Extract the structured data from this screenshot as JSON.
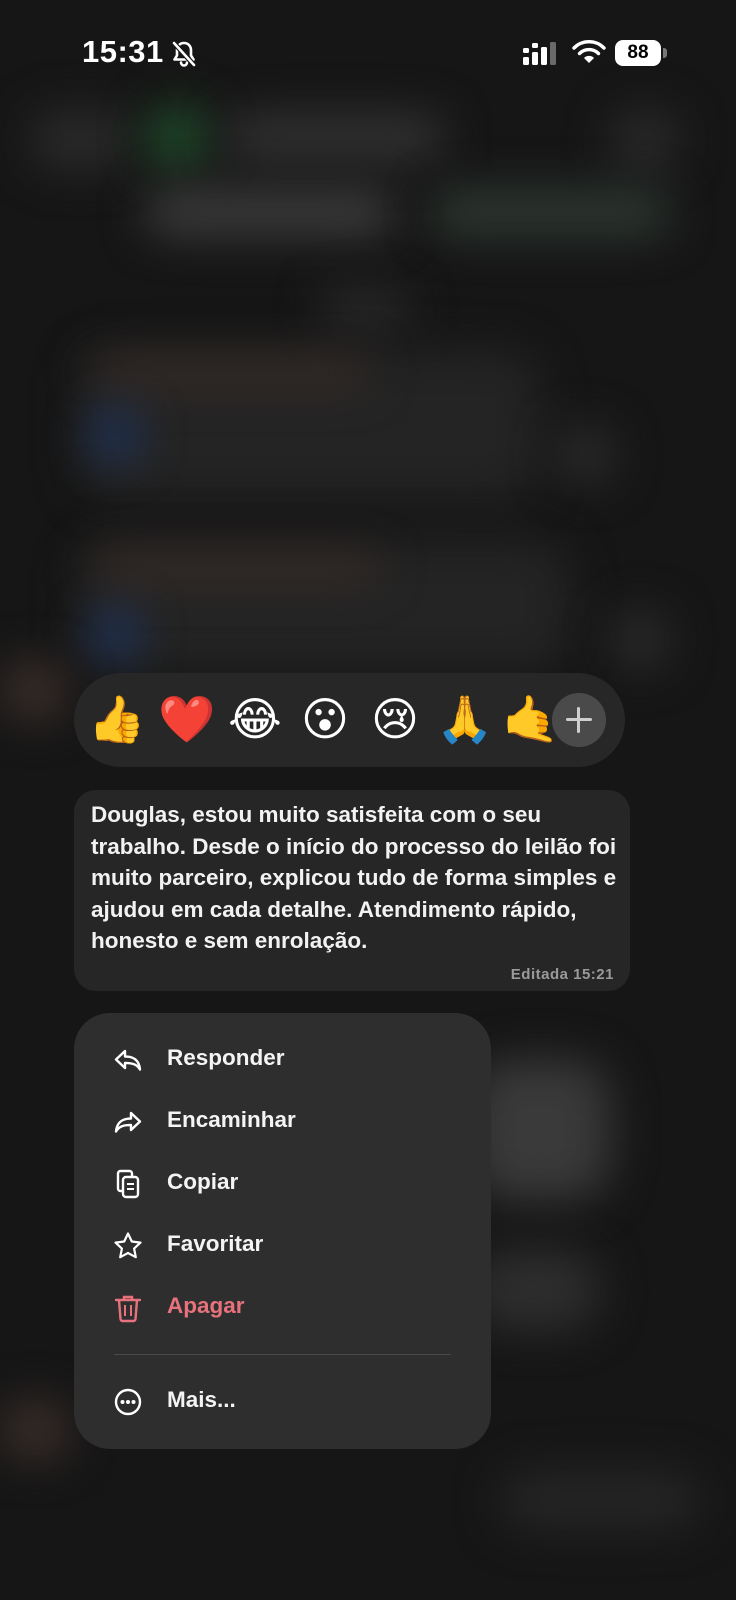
{
  "status_bar": {
    "time": "15:31",
    "battery": "88",
    "icons": [
      "bell-slash-icon",
      "signal-icon",
      "wifi-icon",
      "battery-icon"
    ]
  },
  "reactions": {
    "emojis": [
      "👍",
      "❤️",
      "😂",
      "😮",
      "😢",
      "🙏",
      "🤙"
    ],
    "more_icon": "plus-icon"
  },
  "message": {
    "text": "Douglas, estou muito satisfeita com o seu trabalho. Desde o início do processo do leilão foi muito parceiro, explicou tudo de forma simples e ajudou em cada detalhe. Atendimento rápido, honesto e sem enrolação.",
    "meta": "Editada 15:21"
  },
  "menu": {
    "items": [
      {
        "label": "Responder",
        "icon": "reply-icon"
      },
      {
        "label": "Encaminhar",
        "icon": "forward-icon"
      },
      {
        "label": "Copiar",
        "icon": "copy-icon"
      },
      {
        "label": "Favoritar",
        "icon": "star-icon"
      },
      {
        "label": "Apagar",
        "icon": "trash-icon"
      },
      {
        "label": "Mais...",
        "icon": "more-icon"
      }
    ]
  },
  "colors": {
    "background": "#161616",
    "panel": "#2e2e2e",
    "bubble": "#262626",
    "danger": "#e8727c"
  }
}
